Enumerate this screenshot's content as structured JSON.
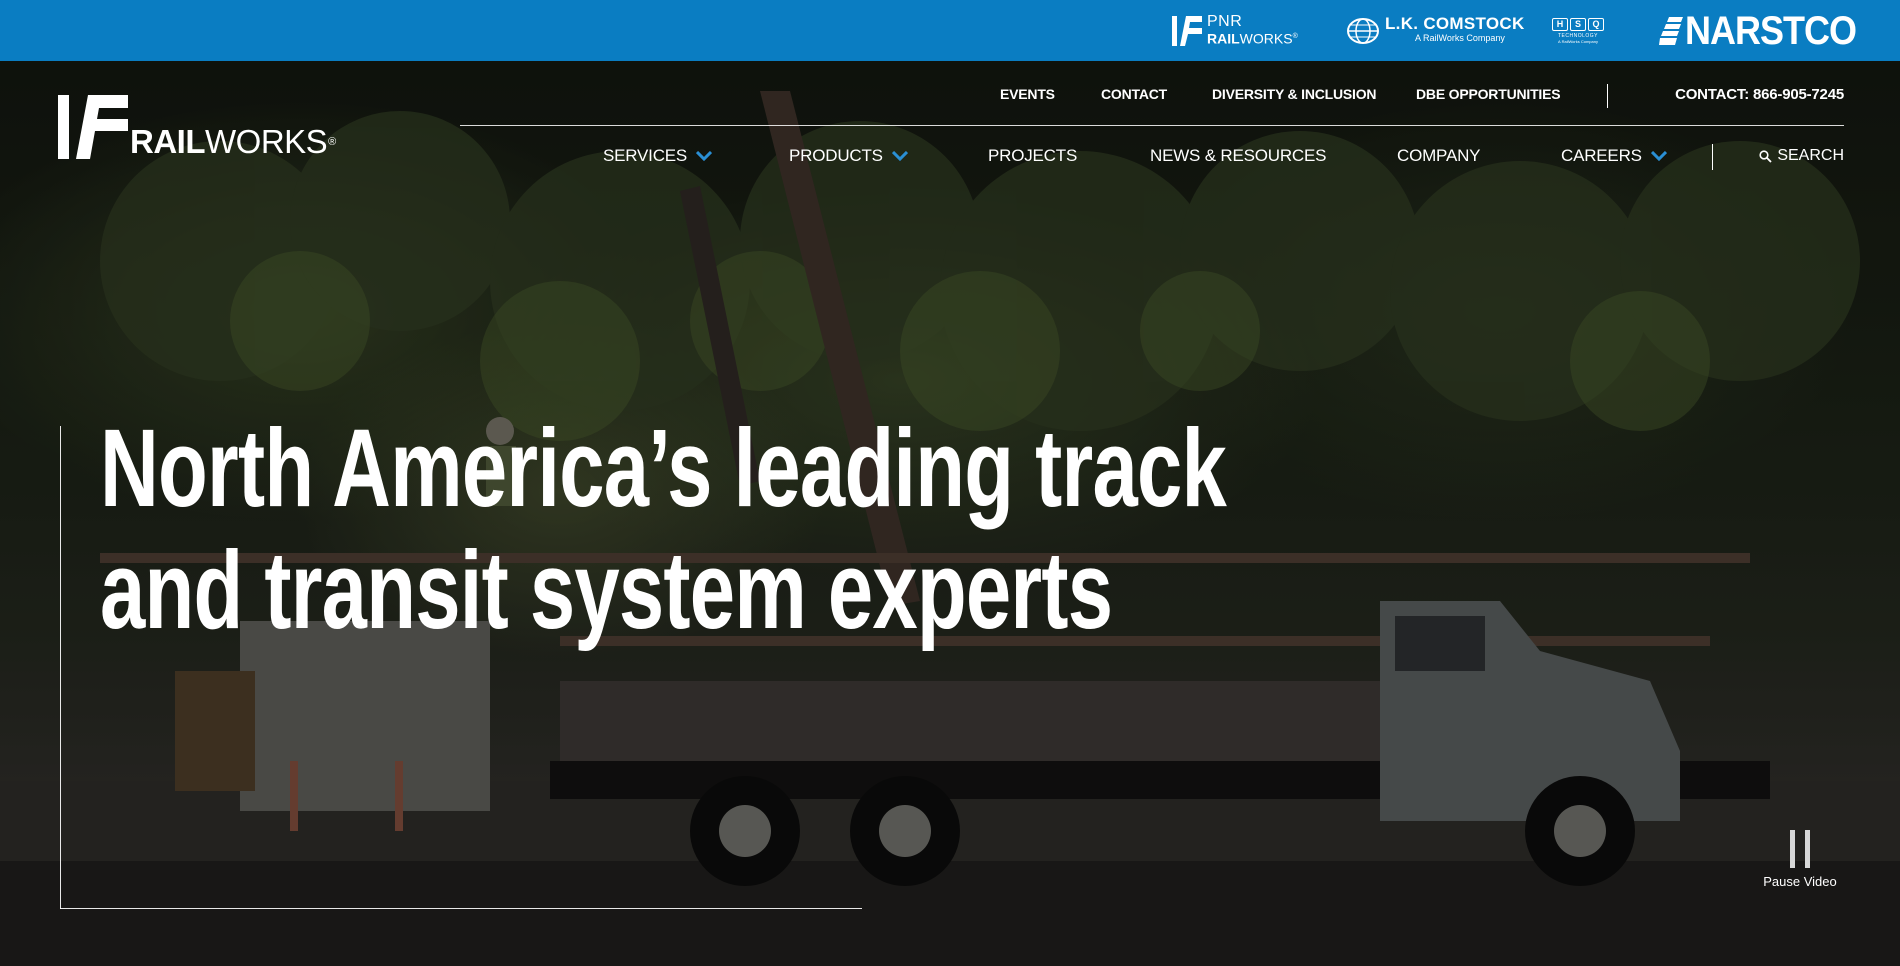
{
  "brand_bar": {
    "color": "#0a7dc2",
    "brands": [
      {
        "name": "pnr-railworks",
        "top": "PNR",
        "bottom_bold": "RAIL",
        "bottom_light": "WORKS",
        "reg": "®"
      },
      {
        "name": "lk-comstock",
        "title": "L.K. COMSTOCK",
        "subtitle": "A RailWorks Company"
      },
      {
        "name": "hsq-technology",
        "letters": [
          "H",
          "S",
          "Q"
        ],
        "tech": "TECHNOLOGY",
        "subtitle": "A RailWorks Company"
      },
      {
        "name": "narstco",
        "title": "NARSTCO"
      }
    ]
  },
  "logo": {
    "bold": "RAIL",
    "light": "WORKS",
    "reg": "®"
  },
  "utility_nav": {
    "links": [
      "EVENTS",
      "CONTACT",
      "DIVERSITY & INCLUSION",
      "DBE OPPORTUNITIES"
    ],
    "phone": "CONTACT: 866-905-7245"
  },
  "main_nav": {
    "items": [
      "SERVICES",
      "PRODUCTS",
      "PROJECTS",
      "NEWS & RESOURCES",
      "COMPANY",
      "CAREERS"
    ],
    "search": "SEARCH",
    "accent": "#2a8fd4",
    "dropdown_icon": "chevron-down-icon"
  },
  "hero": {
    "headline": [
      "North America’s leading track",
      "and transit system experts"
    ],
    "pause_label": "Pause Video"
  }
}
